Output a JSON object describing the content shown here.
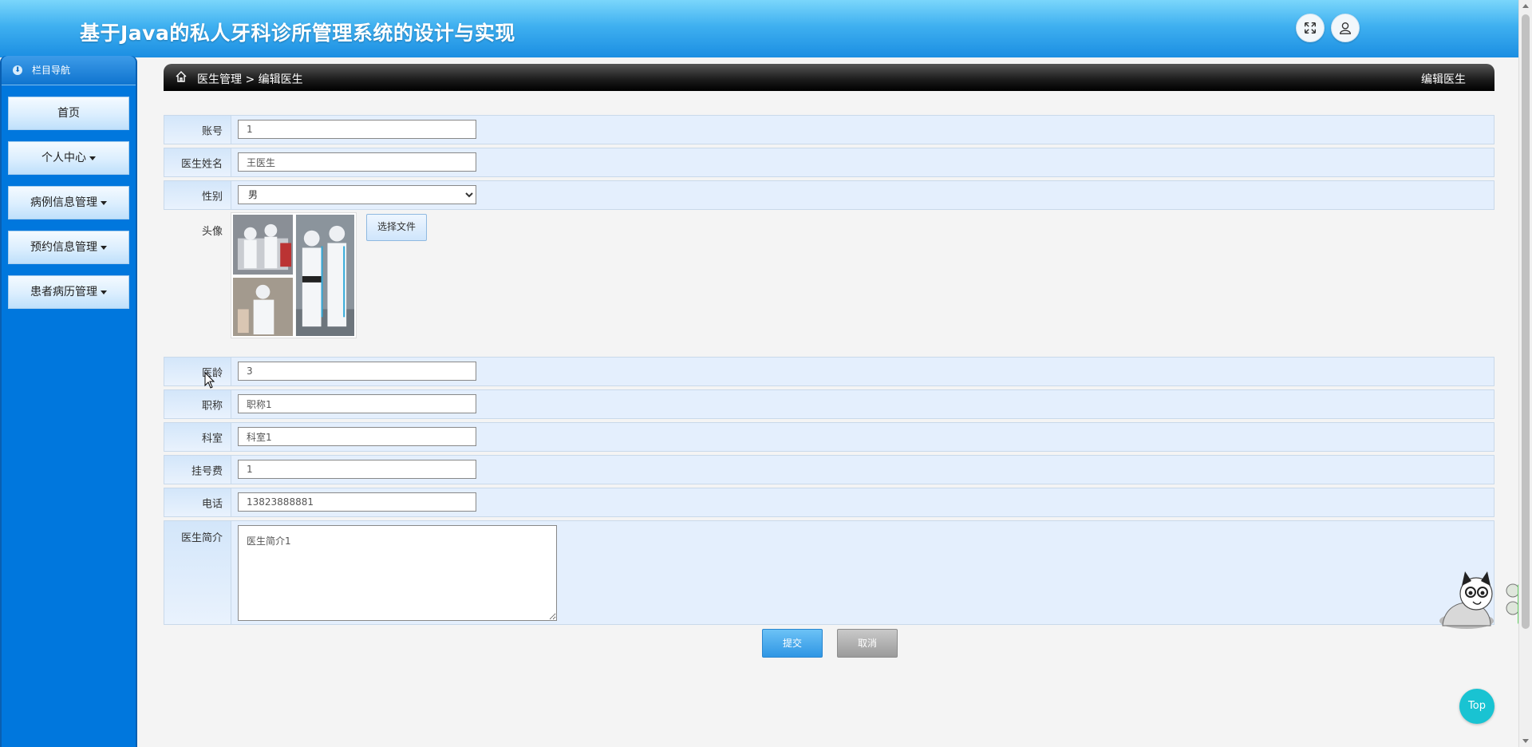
{
  "header": {
    "title": "基于Java的私人牙科诊所管理系统的设计与实现",
    "fullscreen_icon": "expand-icon",
    "user_icon": "user-icon"
  },
  "sidebar": {
    "nav_title": "栏目导航",
    "items": [
      {
        "label": "首页",
        "has_caret": false
      },
      {
        "label": "个人中心",
        "has_caret": true
      },
      {
        "label": "病例信息管理",
        "has_caret": true
      },
      {
        "label": "预约信息管理",
        "has_caret": true
      },
      {
        "label": "患者病历管理",
        "has_caret": true
      }
    ]
  },
  "breadcrumb": {
    "path_parent": "医生管理",
    "separator": ">",
    "path_current": "编辑医生",
    "right_title": "编辑医生"
  },
  "form": {
    "account": {
      "label": "账号",
      "value": "1"
    },
    "name": {
      "label": "医生姓名",
      "value": "王医生"
    },
    "gender": {
      "label": "性别",
      "value": "男"
    },
    "avatar": {
      "label": "头像",
      "file_button": "选择文件"
    },
    "years": {
      "label": "医龄",
      "value": "3"
    },
    "title": {
      "label": "职称",
      "value": "职称1"
    },
    "department": {
      "label": "科室",
      "value": "科室1"
    },
    "fee": {
      "label": "挂号费",
      "value": "1"
    },
    "phone": {
      "label": "电话",
      "value": "13823888881"
    },
    "intro": {
      "label": "医生简介",
      "value": "医生简介1"
    }
  },
  "actions": {
    "submit": "提交",
    "cancel": "取消"
  },
  "top_button": "Top",
  "colors": {
    "header": "#1b8ee2",
    "sidebar": "#0077dd",
    "submit": "#2f96e4",
    "cancel": "#9b9b9b",
    "top_button": "#19c3d2"
  }
}
